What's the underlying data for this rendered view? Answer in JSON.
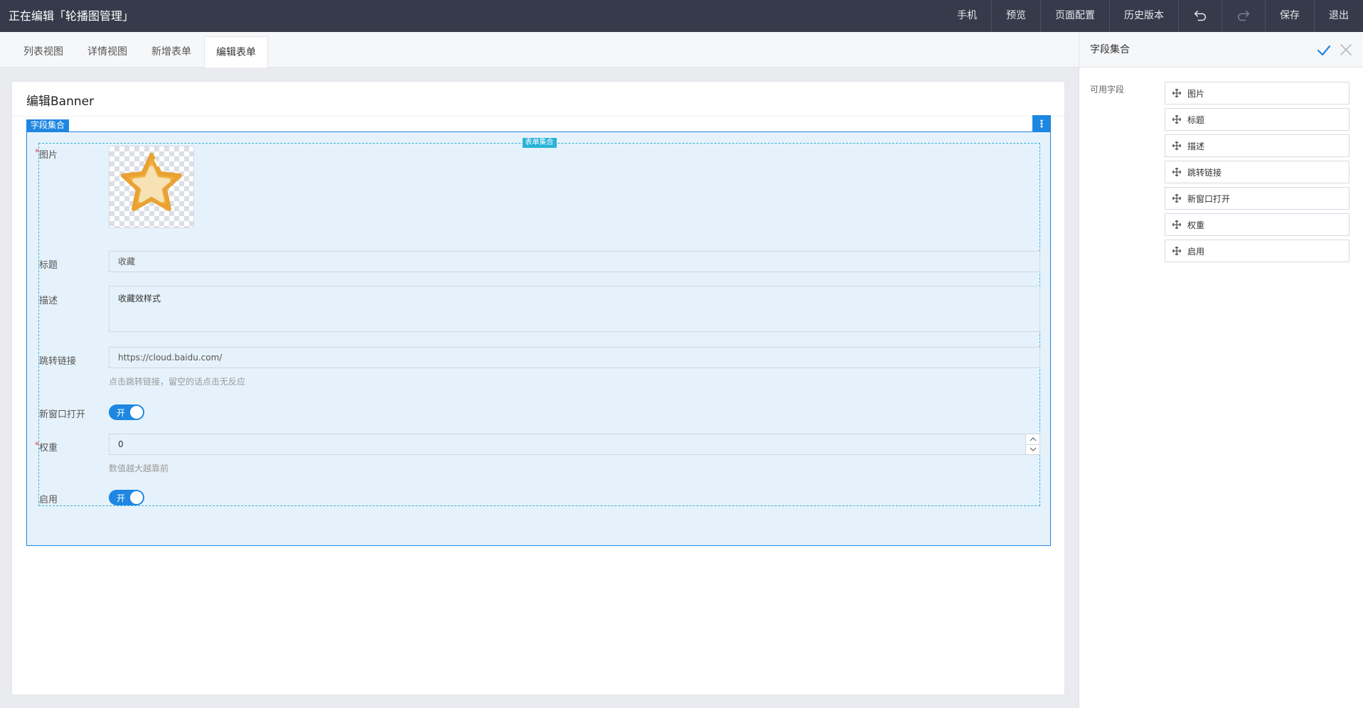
{
  "topbar": {
    "title": "正在编辑「轮播图管理」",
    "actions": {
      "mobile": "手机",
      "preview": "预览",
      "page_config": "页面配置",
      "history": "历史版本",
      "undo_icon": "undo-icon",
      "redo_icon": "redo-icon",
      "save": "保存",
      "exit": "退出"
    }
  },
  "tabs": [
    {
      "label": "列表视图"
    },
    {
      "label": "详情视图"
    },
    {
      "label": "新增表单"
    },
    {
      "label": "编辑表单",
      "active": true
    }
  ],
  "page": {
    "title": "编辑Banner",
    "fieldset_tag": "字段集合",
    "formgroup_tag": "表单集合"
  },
  "form": {
    "image": {
      "label": "图片",
      "required": "*"
    },
    "title": {
      "label": "标题",
      "value": "收藏"
    },
    "description": {
      "label": "描述",
      "value": "收藏效样式"
    },
    "link": {
      "label": "跳转链接",
      "value": "https://cloud.baidu.com/",
      "hint": "点击跳转链接，留空的话点击无反应"
    },
    "new_window": {
      "label": "新窗口打开",
      "switch_text": "开",
      "on": true
    },
    "weight": {
      "label": "权重",
      "required": "*",
      "value": "0",
      "hint": "数值越大越靠前"
    },
    "enabled": {
      "label": "启用",
      "switch_text": "开",
      "on": true
    }
  },
  "right_panel": {
    "title": "字段集合",
    "available_label": "可用字段",
    "fields": [
      "图片",
      "标题",
      "描述",
      "跳转链接",
      "新窗口打开",
      "权重",
      "启用"
    ]
  },
  "colors": {
    "topbar_bg": "#353b4a",
    "accent": "#1e87e1",
    "fieldset_bg": "#e6f2fb",
    "formgroup_border": "#36b0d8",
    "star": "#f2b340"
  }
}
